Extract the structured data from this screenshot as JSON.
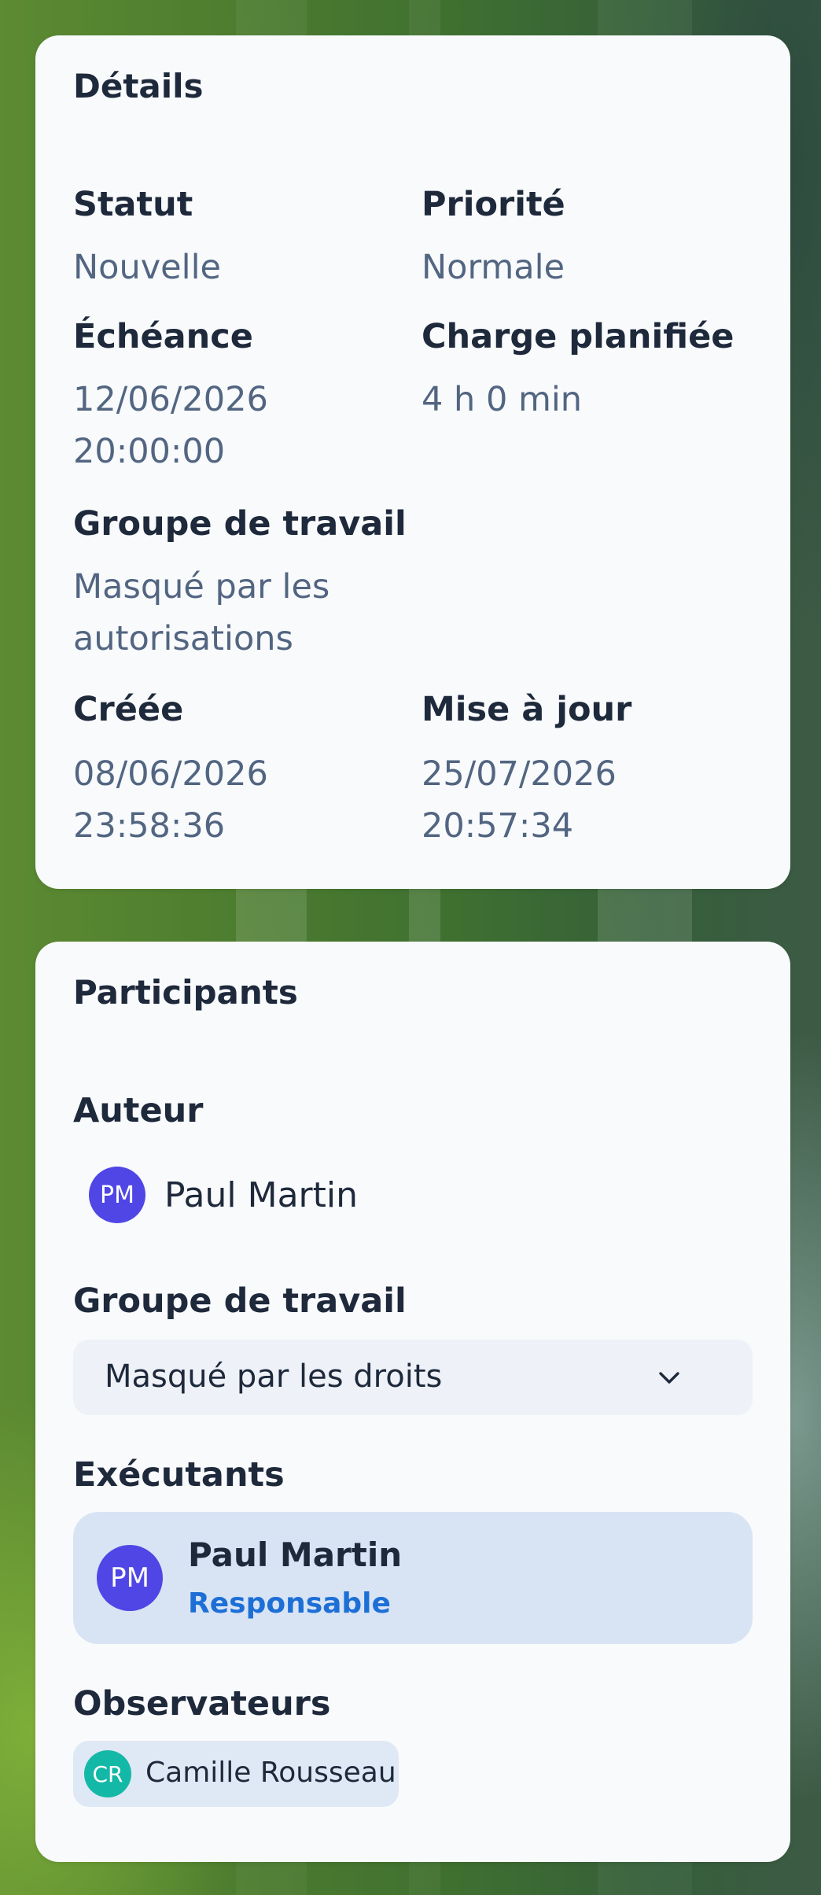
{
  "details": {
    "title": "Détails",
    "status_label": "Statut",
    "status_value": "Nouvelle",
    "priority_label": "Priorité",
    "priority_value": "Normale",
    "due_label": "Échéance",
    "due_value": "12/06/2026\n20:00:00",
    "planned_label": "Charge planifiée",
    "planned_value": "4 h 0 min",
    "group_label": "Groupe de travail",
    "group_value": "Masqué par les\nautorisations",
    "created_label": "Créée",
    "created_value": "08/06/2026\n23:58:36",
    "updated_label": "Mise à jour",
    "updated_value": "25/07/2026\n20:57:34"
  },
  "participants": {
    "title": "Participants",
    "author_label": "Auteur",
    "author": {
      "initials": "PM",
      "name": "Paul Martin",
      "avatar_color": "#4f46e5"
    },
    "group_label": "Groupe de travail",
    "group_select_value": "Masqué par les droits",
    "group_select_icon": "chevron-down-icon",
    "executors_label": "Exécutants",
    "executor": {
      "initials": "PM",
      "name": "Paul Martin",
      "role": "Responsable",
      "avatar_color": "#4f46e5",
      "role_color": "#1d6fd6"
    },
    "observers_label": "Observateurs",
    "observer": {
      "initials": "CR",
      "name": "Camille Rousseau",
      "avatar_color": "#14b8a6"
    }
  },
  "colors": {
    "card_background": "#f8fafc",
    "text_primary": "#1e293b",
    "text_secondary": "#526581",
    "select_background": "#eef2f8",
    "executor_background": "#d8e4f4",
    "chip_background": "#dfe8f5"
  }
}
